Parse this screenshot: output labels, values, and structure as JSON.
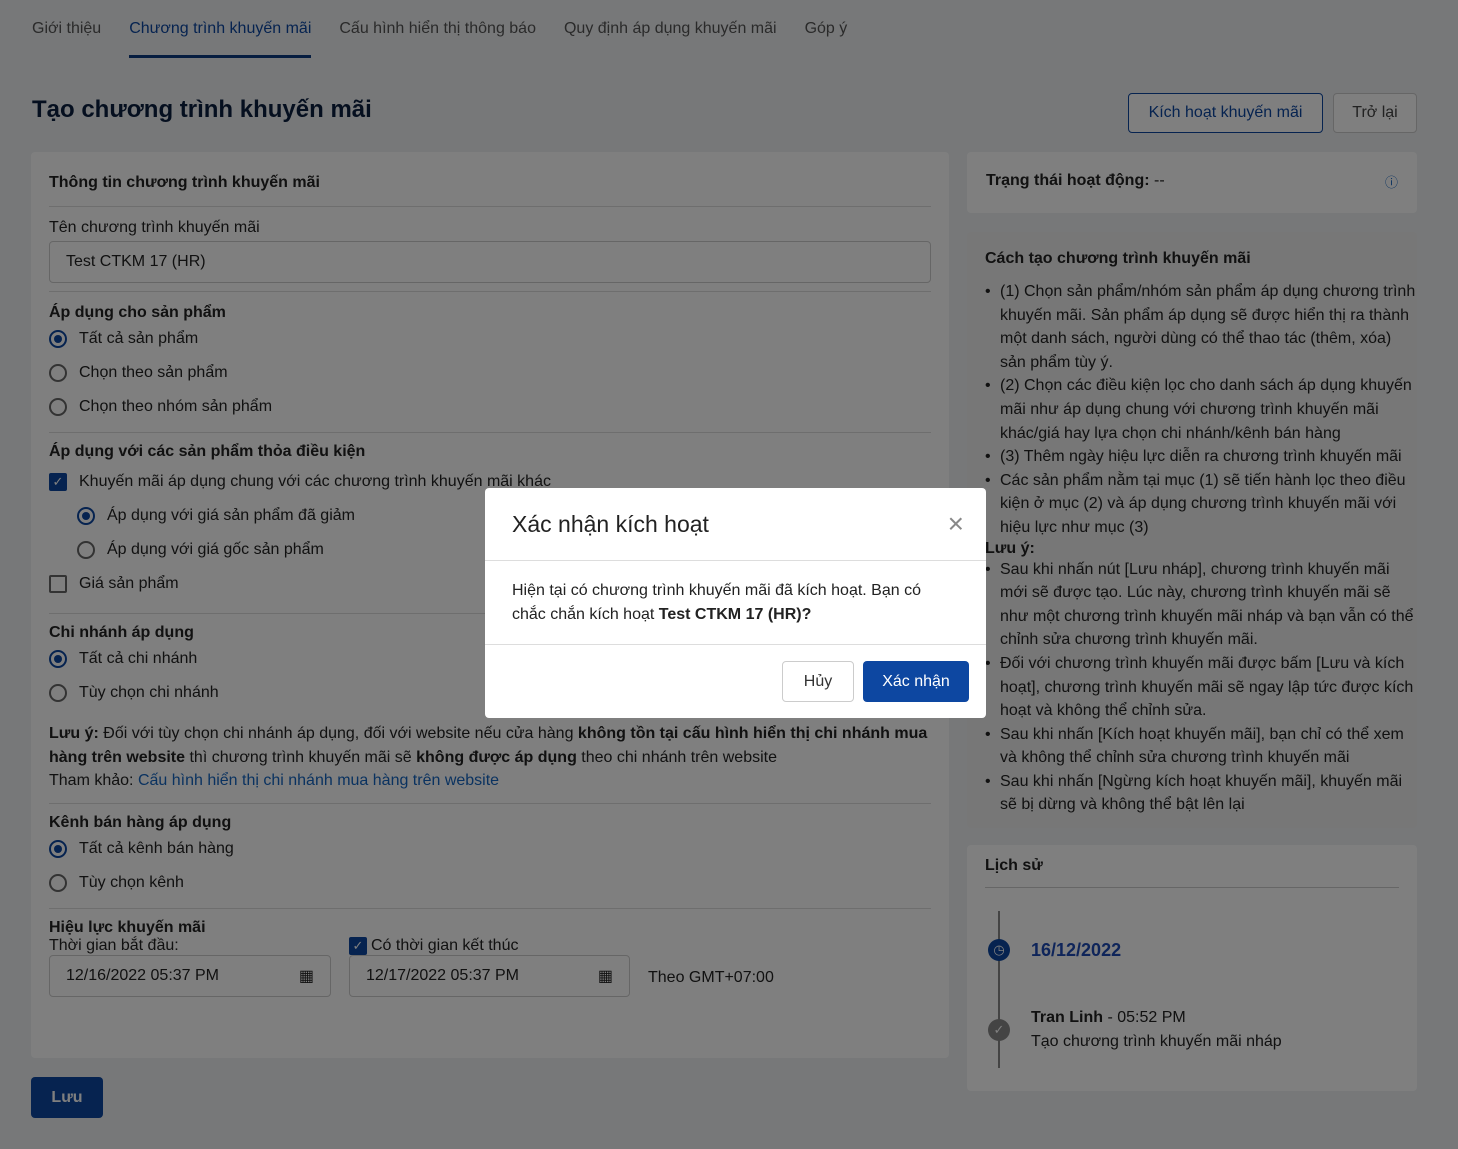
{
  "tabs": [
    "Giới thiệu",
    "Chương trình khuyến mãi",
    "Cấu hình hiển thị thông báo",
    "Quy định áp dụng khuyến mãi",
    "Góp ý"
  ],
  "page_title": "Tạo chương trình khuyến mãi",
  "activate_button": "Kích hoạt khuyến mãi",
  "back_button": "Trở lại",
  "form": {
    "section_title": "Thông tin chương trình khuyến mãi",
    "name_label": "Tên chương trình khuyến mãi",
    "name_value": "Test CTKM 17 (HR)",
    "products_title": "Áp dụng cho sản phẩm",
    "products_options": [
      "Tất cả sản phẩm",
      "Chọn theo sản phẩm",
      "Chọn theo nhóm sản phẩm"
    ],
    "cond_title": "Áp dụng với các sản phẩm thỏa điều kiện",
    "cond_combine": "Khuyến mãi áp dụng chung với các chương trình khuyến mãi khác",
    "cond_sub": [
      "Áp dụng với giá sản phẩm đã giảm",
      "Áp dụng với giá gốc sản phẩm"
    ],
    "cond_price": "Giá sản phẩm",
    "branch_title": "Chi nhánh áp dụng",
    "branch_options": [
      "Tất cả chi nhánh",
      "Tùy chọn chi nhánh"
    ],
    "note_prefix": "Lưu ý:",
    "note_1": " Đối với tùy chọn chi nhánh áp dụng, đối với website nếu cửa hàng ",
    "note_b1": "không tồn tại cấu hình hiển thị chi nhánh mua hàng trên website",
    "note_2": " thì chương trình khuyến mãi sẽ ",
    "note_b2": "không được áp dụng",
    "note_3": " theo chi nhánh trên website",
    "ref_label": "Tham khảo: ",
    "ref_link": "Cấu hình hiển thị chi nhánh mua hàng trên website",
    "channel_title": "Kênh bán hàng áp dụng",
    "channel_options": [
      "Tất cả kênh bán hàng",
      "Tùy chọn kênh"
    ],
    "validity_title": "Hiệu lực khuyến mãi",
    "start_label": "Thời gian bắt đầu:",
    "start_value": "12/16/2022 05:37 PM",
    "end_label": "Có thời gian kết thúc",
    "end_value": "12/17/2022 05:37 PM",
    "timezone": "Theo GMT+07:00"
  },
  "save_button": "Lưu",
  "status": {
    "label": "Trạng thái hoạt động:",
    "value": " --"
  },
  "guide": {
    "title": "Cách tạo chương trình khuyến mãi",
    "items": [
      "(1) Chọn sản phẩm/nhóm sản phẩm áp dụng chương trình khuyến mãi. Sản phẩm áp dụng sẽ được hiển thị ra thành một danh sách, người dùng có thể thao tác (thêm, xóa) sản phẩm tùy ý.",
      "(2) Chọn các điều kiện lọc cho danh sách áp dụng khuyến mãi như áp dụng chung với chương trình khuyến mãi khác/giá hay lựa chọn chi nhánh/kênh bán hàng",
      "(3) Thêm ngày hiệu lực diễn ra chương trình khuyến mãi",
      "Các sản phẩm nằm tại mục (1) sẽ tiến hành lọc theo điều kiện ở mục (2) và áp dụng chương trình khuyến mãi với hiệu lực như mục (3)"
    ],
    "note_title": "Lưu ý:",
    "notes": [
      "Sau khi nhấn nút [Lưu nháp], chương trình khuyến mãi mới sẽ được tạo. Lúc này, chương trình khuyến mãi sẽ như một chương trình khuyến mãi nháp và bạn vẫn có thể chỉnh sửa chương trình khuyến mãi.",
      "Đối với chương trình khuyến mãi được bấm [Lưu và kích hoạt], chương trình khuyến mãi sẽ ngay lập tức được kích hoạt và không thể chỉnh sửa.",
      "Sau khi nhấn [Kích hoạt khuyến mãi], bạn chỉ có thể xem và không thể chỉnh sửa chương trình khuyến mãi",
      "Sau khi nhấn [Ngừng kích hoạt khuyến mãi], khuyến mãi sẽ bị dừng và không thể bật lên lại"
    ]
  },
  "history": {
    "title": "Lịch sử",
    "date": "16/12/2022",
    "user": "Tran Linh",
    "time": " - 05:52 PM",
    "action": "Tạo chương trình khuyến mãi nháp"
  },
  "modal": {
    "title": "Xác nhận kích hoạt",
    "body": "Hiện tại có chương trình khuyến mãi đã kích hoạt. Bạn có chắc chắn kích hoạt ",
    "body_bold": "Test CTKM 17 (HR)?",
    "cancel": "Hủy",
    "confirm": "Xác nhận"
  }
}
